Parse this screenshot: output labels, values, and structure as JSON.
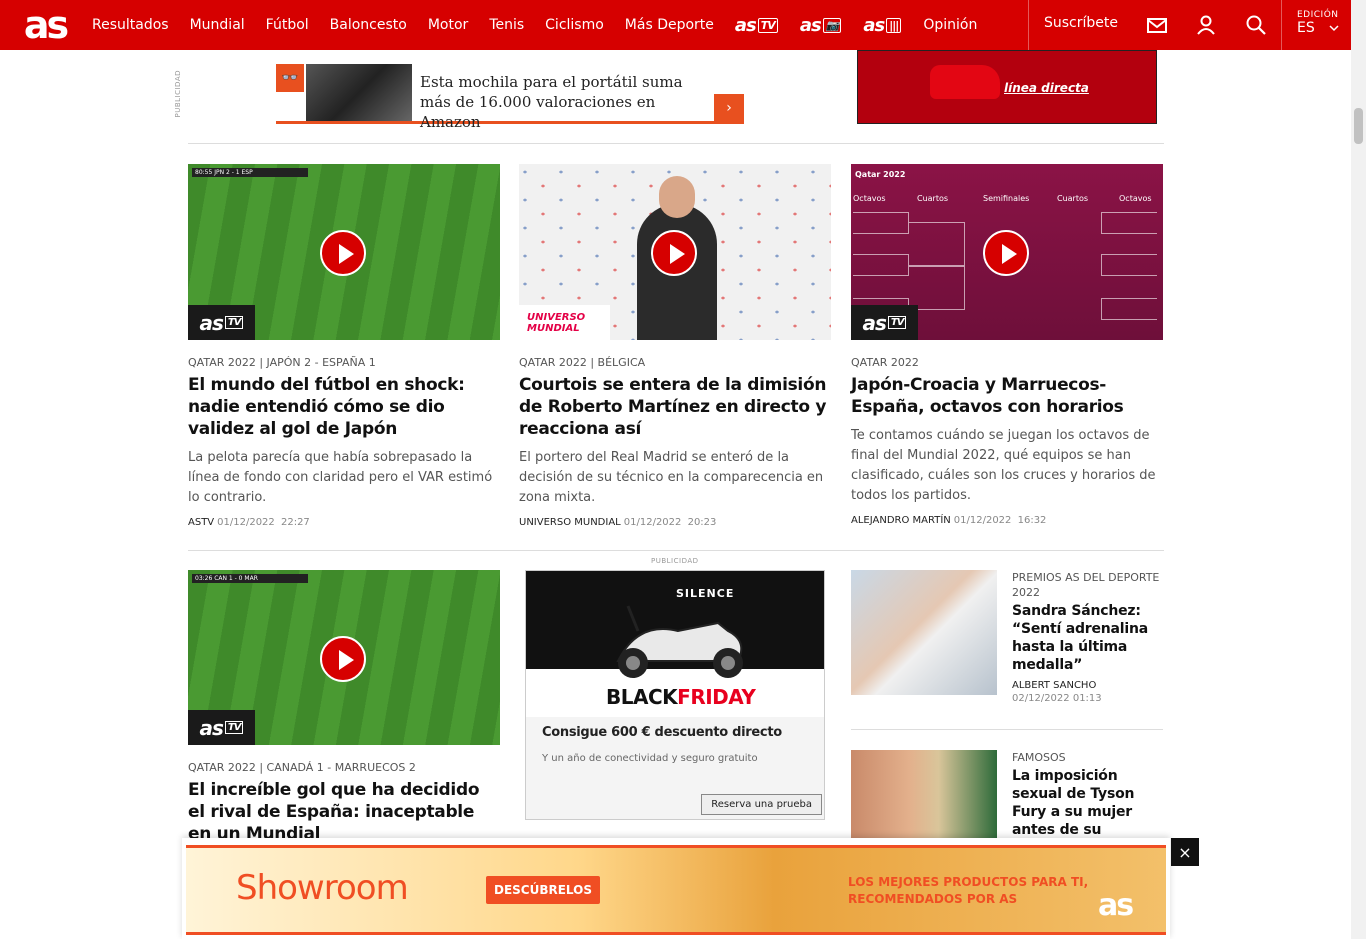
{
  "header": {
    "logo": "as",
    "nav": [
      "Resultados",
      "Mundial",
      "Fútbol",
      "Baloncesto",
      "Motor",
      "Tenis",
      "Ciclismo",
      "Más Deporte"
    ],
    "brands": [
      {
        "name": "as",
        "suffix": "TV"
      },
      {
        "name": "as",
        "suffix": "📷"
      },
      {
        "name": "as",
        "suffix": "|||"
      }
    ],
    "opinion": "Opinión",
    "subscribe": "Suscríbete",
    "edition_label": "EDICIÓN",
    "edition_value": "ES",
    "icons": [
      "mail-icon",
      "user-icon",
      "search-icon",
      "chevron-down-icon"
    ],
    "accent": "#d60000"
  },
  "ads_top": {
    "publicidad": "PUBLICIDAD",
    "amazon_text": "Esta mochila para el portátil suma más de 16.000 valoraciones en Amazon",
    "linea_text": "línea directa"
  },
  "cards_row1": [
    {
      "kicker": "QATAR 2022 | JAPÓN 2 - ESPAÑA 1",
      "title": "El mundo del fútbol en shock: nadie entendió cómo se dio validez al gol de Japón",
      "desc": "La pelota parecía que había sobrepasado la línea de fondo con claridad pero el VAR estimó lo contrario.",
      "author": "ASTV",
      "date": "01/12/2022",
      "time": "22:27",
      "badge": "as TV"
    },
    {
      "kicker": "QATAR 2022 | BÉLGICA",
      "title": "Courtois se entera de la dimisión de Roberto Martínez en directo y reacciona así",
      "desc": "El portero del Real Madrid se enteró de la decisión de su técnico en la comparecencia en zona mixta.",
      "author": "UNIVERSO MUNDIAL",
      "date": "01/12/2022",
      "time": "20:23",
      "badge": "UNIVERSO MUNDIAL"
    },
    {
      "kicker": "QATAR 2022",
      "title": "Japón-Croacia y Marruecos-España, octavos con horarios",
      "desc": "Te contamos cuándo se juegan los octavos de final del Mundial 2022, qué equipos se han clasificado, cuáles son los cruces y horarios de todos los partidos.",
      "author": "ALEJANDRO MARTÍN",
      "date": "01/12/2022",
      "time": "16:32",
      "badge": "as TV"
    }
  ],
  "bracket": {
    "title": "Qatar 2022",
    "headers": [
      "Octavos",
      "Cuartos",
      "Semifinales",
      "Cuartos",
      "Octavos"
    ]
  },
  "card_row2": {
    "kicker": "QATAR 2022 | CANADÁ 1 - MARRUECOS 2",
    "title": "El increíble gol que ha decidido el rival de España: inaceptable en un Mundial",
    "badge": "as TV"
  },
  "ad_silence": {
    "publicidad": "PUBLICIDAD",
    "brand": "SILENCE",
    "black": "BLACK",
    "friday": "FRIDAY",
    "headline": "Consigue 600 € descuento directo",
    "sub": "Y un año de conectividad y seguro gratuito",
    "button": "Reserva una prueba"
  },
  "side": [
    {
      "kicker": "PREMIOS AS DEL DEPORTE 2022",
      "title": "Sandra Sánchez: “Sentí adrenalina hasta la última medalla”",
      "author": "ALBERT SANCHO",
      "date": "02/12/2022",
      "time": "01:13"
    },
    {
      "kicker": "FAMOSOS",
      "title": "La imposición sexual de Tyson Fury a su mujer antes de su combate"
    }
  ],
  "sticky_ad": {
    "brand": "Showroom",
    "cta": "DESCÚBRELOS",
    "claim": "LOS MEJORES PRODUCTOS PARA TI, RECOMENDADOS POR AS",
    "logo": "as",
    "close": "×"
  },
  "scoreboards": [
    "80:55  JPN 2 - 1 ESP",
    "03:26  CAN 1 - 0 MAR"
  ]
}
